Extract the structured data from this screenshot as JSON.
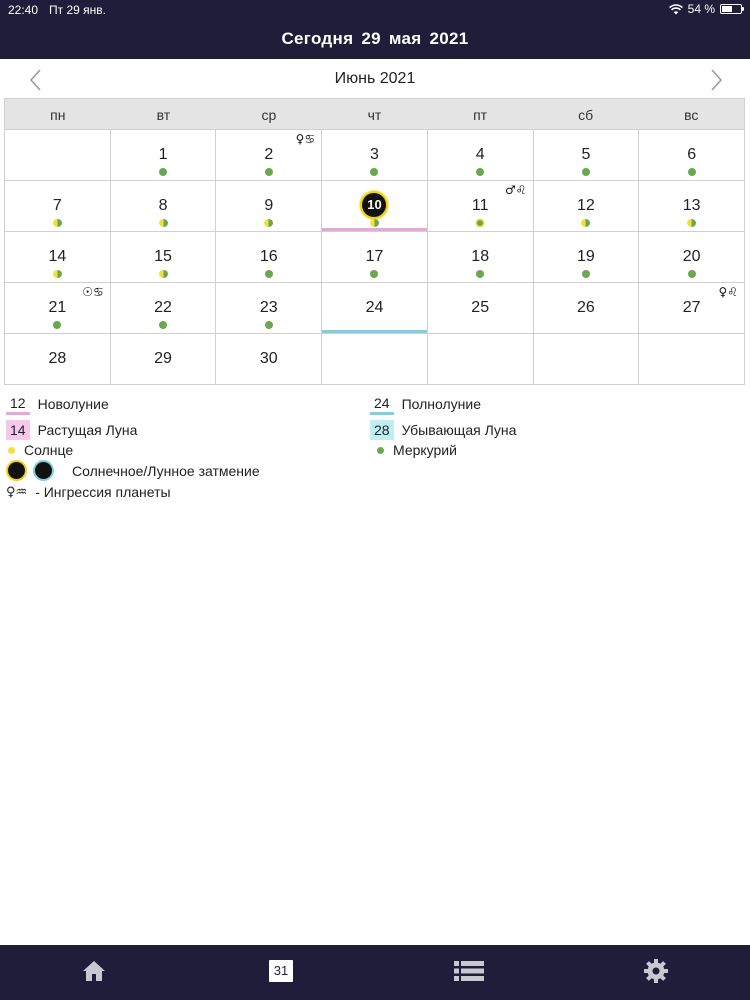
{
  "status": {
    "time": "22:40",
    "date": "Пт 29 янв.",
    "battery": "54 %",
    "battery_level": 0.54
  },
  "header": {
    "today": "Сегодня  29  мая  2021"
  },
  "month": {
    "title": "Июнь 2021"
  },
  "weekdays": [
    "пн",
    "вт",
    "ср",
    "чт",
    "пт",
    "сб",
    "вс"
  ],
  "days": [
    {
      "num": ""
    },
    {
      "num": "1",
      "dot": "green"
    },
    {
      "num": "2",
      "dot": "green",
      "ingress": "♀♋"
    },
    {
      "num": "3",
      "dot": "green"
    },
    {
      "num": "4",
      "dot": "green"
    },
    {
      "num": "5",
      "dot": "green"
    },
    {
      "num": "6",
      "dot": "green"
    },
    {
      "num": "7",
      "dot": "half"
    },
    {
      "num": "8",
      "dot": "half"
    },
    {
      "num": "9",
      "dot": "half"
    },
    {
      "num": "10",
      "dot": "half",
      "eclipse": "solar",
      "bar": "pink"
    },
    {
      "num": "11",
      "dot": "sun-small",
      "ingress": "♂♌"
    },
    {
      "num": "12",
      "dot": "half"
    },
    {
      "num": "13",
      "dot": "half"
    },
    {
      "num": "14",
      "dot": "half"
    },
    {
      "num": "15",
      "dot": "half"
    },
    {
      "num": "16",
      "dot": "green"
    },
    {
      "num": "17",
      "dot": "green"
    },
    {
      "num": "18",
      "dot": "green"
    },
    {
      "num": "19",
      "dot": "green"
    },
    {
      "num": "20",
      "dot": "green"
    },
    {
      "num": "21",
      "dot": "green",
      "ingress": "☉♋"
    },
    {
      "num": "22",
      "dot": "green"
    },
    {
      "num": "23",
      "dot": "green"
    },
    {
      "num": "24",
      "bar": "cyan"
    },
    {
      "num": "25"
    },
    {
      "num": "26"
    },
    {
      "num": "27",
      "ingress": "♀♌"
    },
    {
      "num": "28"
    },
    {
      "num": "29"
    },
    {
      "num": "30"
    },
    {
      "num": ""
    },
    {
      "num": ""
    },
    {
      "num": ""
    },
    {
      "num": ""
    }
  ],
  "legend": {
    "new_moon": {
      "num": "12",
      "label": "Новолуние",
      "color": "#e9a6d8"
    },
    "full_moon": {
      "num": "24",
      "label": "Полнолуние",
      "color": "#7fd0dc"
    },
    "waxing": {
      "num": "14",
      "label": "Растущая Луна",
      "color": "#f6c8ec"
    },
    "waning": {
      "num": "28",
      "label": "Убывающая Луна",
      "color": "#bfeef3"
    },
    "sun": {
      "label": "Солнце",
      "color": "#f4e039"
    },
    "mercury": {
      "label": "Меркурий",
      "color": "#6aa84f"
    },
    "eclipse": {
      "label": "Солнечное/Лунное затмение"
    },
    "ingress": {
      "symbol": "♀♒",
      "label": "-  Ингрессия  планеты"
    }
  },
  "tabs": [
    {
      "name": "home",
      "icon": "home-icon"
    },
    {
      "name": "calendar",
      "icon": "calendar-icon",
      "label": "31"
    },
    {
      "name": "list",
      "icon": "list-icon"
    },
    {
      "name": "settings",
      "icon": "gear-icon"
    }
  ]
}
